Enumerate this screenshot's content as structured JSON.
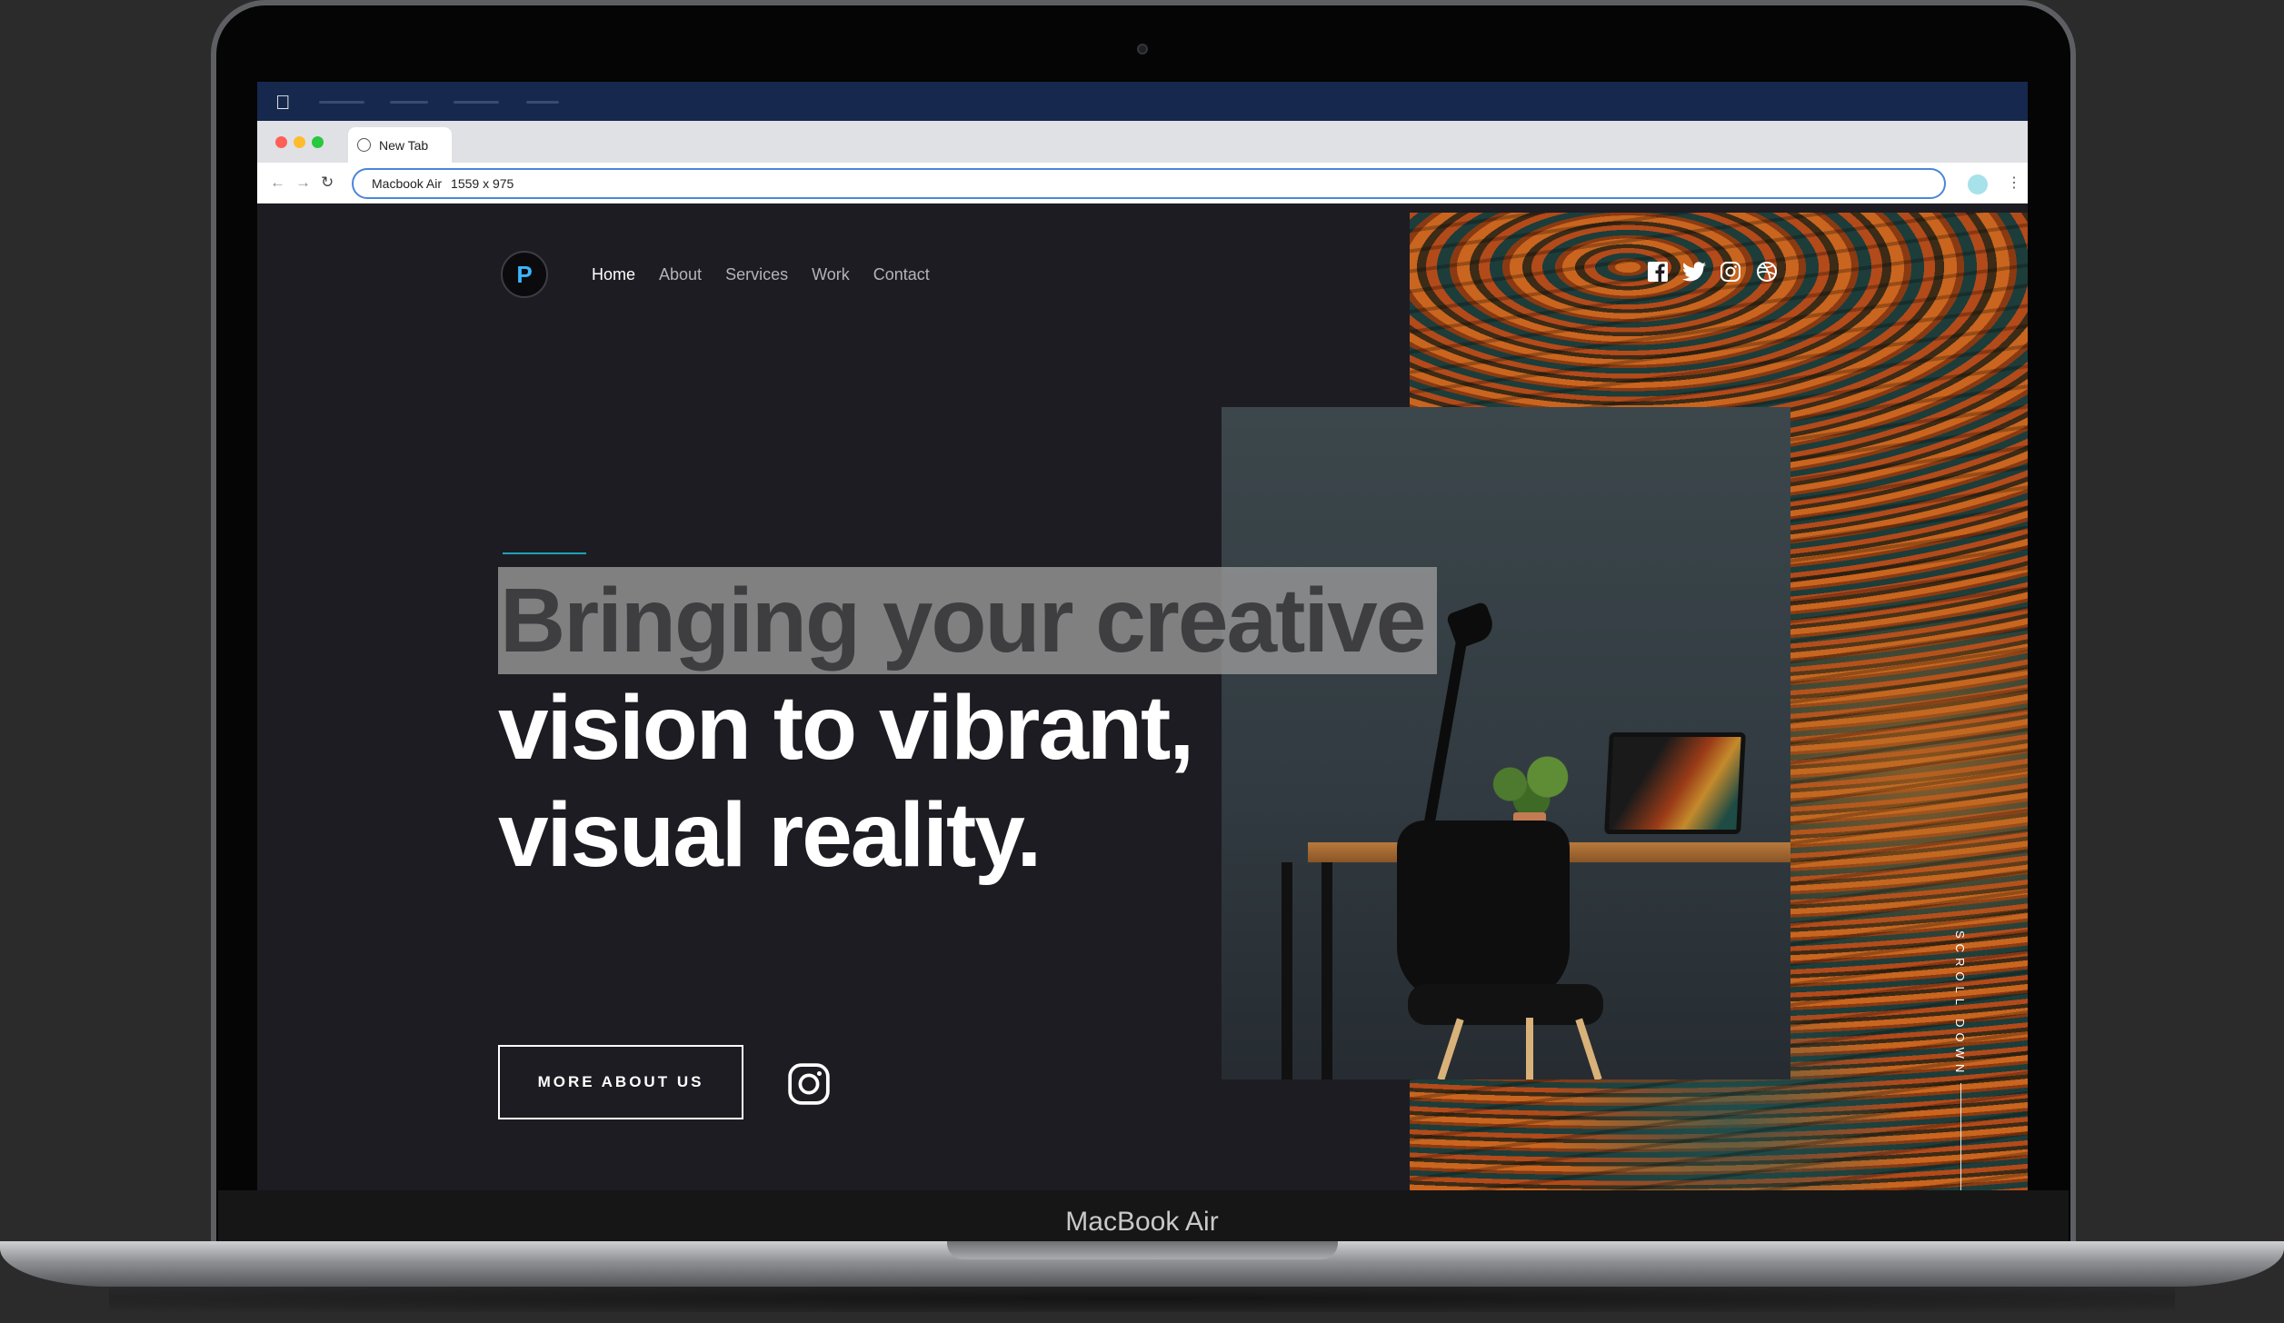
{
  "device": {
    "label": "MacBook Air"
  },
  "browser": {
    "tab_title": "New Tab",
    "address": "Macbook Air",
    "viewport_size": "1559 x 975"
  },
  "site": {
    "logo_letter": "P",
    "nav": [
      {
        "label": "Home",
        "active": true
      },
      {
        "label": "About",
        "active": false
      },
      {
        "label": "Services",
        "active": false
      },
      {
        "label": "Work",
        "active": false
      },
      {
        "label": "Contact",
        "active": false
      }
    ],
    "social": [
      "facebook-icon",
      "twitter-icon",
      "instagram-icon",
      "dribbble-icon"
    ],
    "headline": {
      "line1": "Bringing your creative",
      "line2": "vision to vibrant,",
      "line3": "visual reality."
    },
    "cta_label": "MORE ABOUT US",
    "scroll_label": "SCROLL DOWN"
  },
  "colors": {
    "background": "#1d1c22",
    "accent": "#1ca3b8",
    "menubar": "#16284d"
  }
}
